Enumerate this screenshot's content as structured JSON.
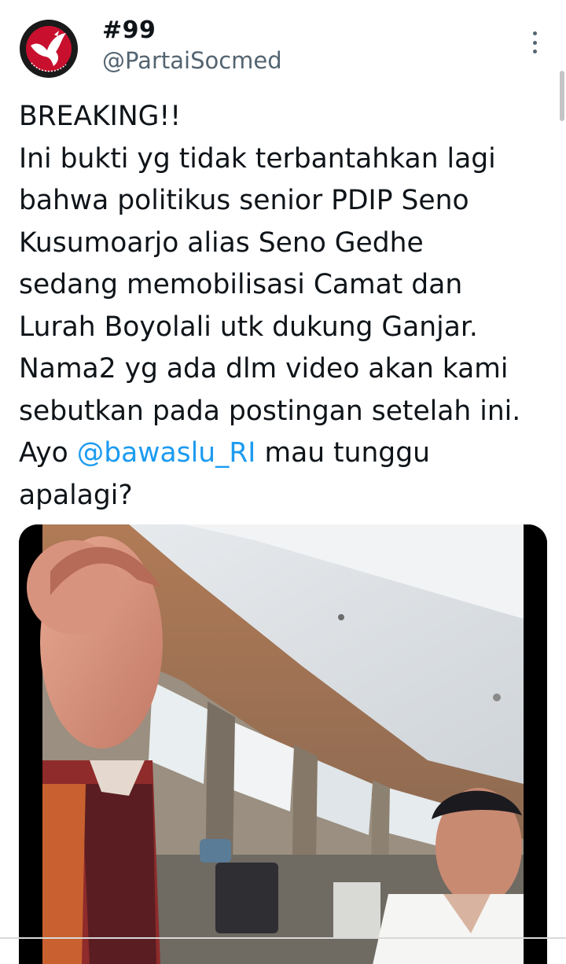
{
  "author": {
    "display_name": "#99",
    "handle": "@PartaiSocmed",
    "avatar_icon": "bird-logo-icon"
  },
  "tweet": {
    "text_before_mention": "BREAKING!!\nIni bukti yg tidak terbantahkan lagi\nbahwa politikus senior PDIP Seno\nKusumoarjo alias Seno Gedhe\nsedang memobilisasi Camat dan\nLurah Boyolali utk dukung Ganjar.\nNama2 yg ada dlm video akan kami\nsebutkan pada postingan setelah ini.\nAyo ",
    "mention": "@bawaslu_RI",
    "text_after_mention": " mau tunggu\napalagi?"
  },
  "media": {
    "type": "video-thumbnail"
  },
  "colors": {
    "link": "#1d9bf0",
    "secondary_text": "#536471",
    "primary_text": "#0f1419"
  }
}
